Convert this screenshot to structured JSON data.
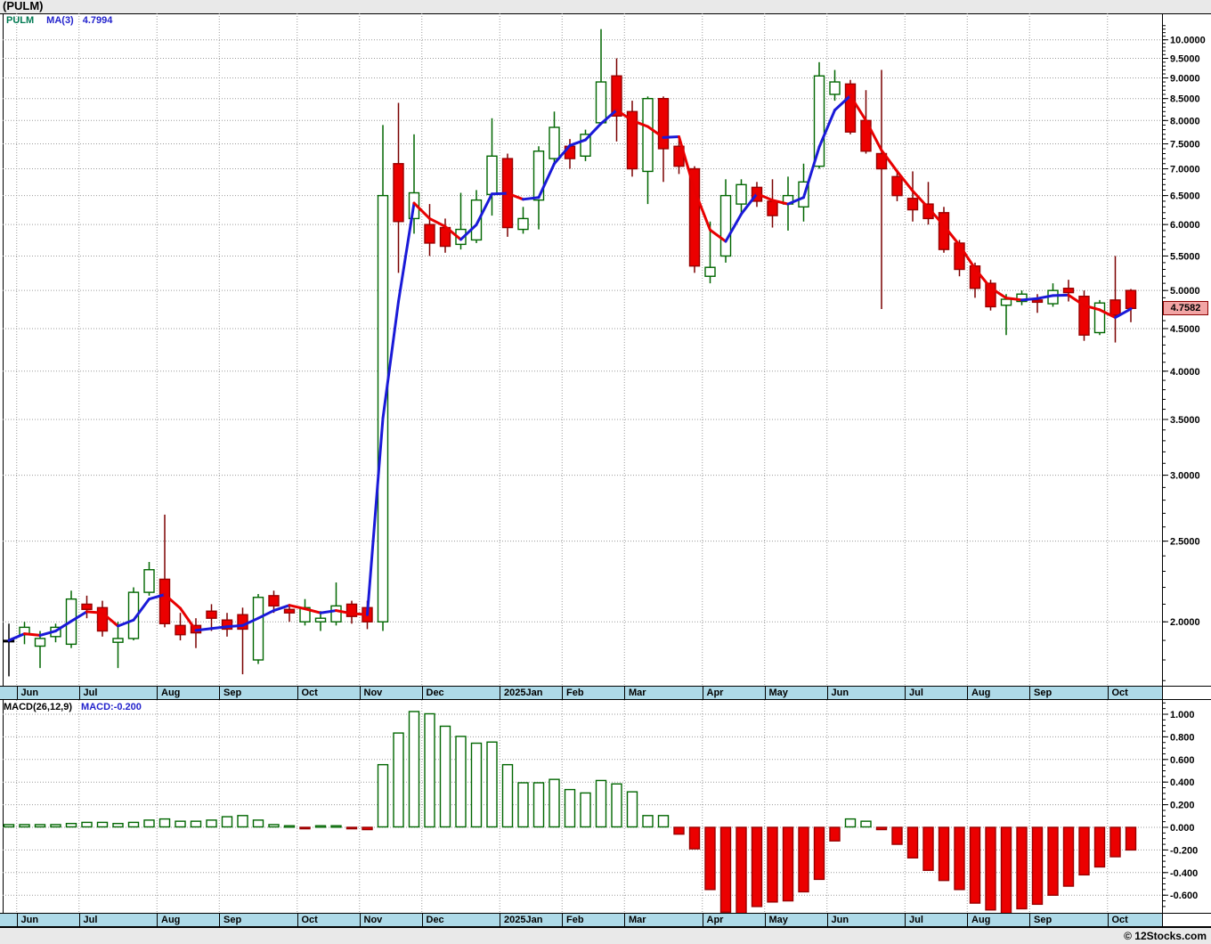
{
  "title": "(PULM)",
  "footer": "© 12Stocks.com",
  "price_chart": {
    "legend": {
      "symbol": "PULM",
      "ma_label": "MA(3)",
      "ma_value": "4.7994"
    },
    "last_price_badge": "4.7582",
    "axis_labels": [
      "10.0000",
      "9.5000",
      "9.0000",
      "8.5000",
      "8.0000",
      "7.5000",
      "7.0000",
      "6.5000",
      "6.0000",
      "5.5000",
      "5.0000",
      "4.5000",
      "4.0000",
      "3.5000",
      "3.0000",
      "2.5000",
      "2.0000"
    ]
  },
  "macd_panel": {
    "legend_label": "MACD(26,12,9)",
    "legend_value": "MACD:-0.200",
    "axis_labels": [
      "1.000",
      "0.800",
      "0.600",
      "0.400",
      "0.200",
      "0.000",
      "-0.200",
      "-0.400",
      "-0.600"
    ]
  },
  "month_axis": {
    "labels": [
      "Jun",
      "Jul",
      "Aug",
      "Sep",
      "Oct",
      "Nov",
      "Dec",
      "2025Jan",
      "Feb",
      "Mar",
      "Apr",
      "May",
      "Jun",
      "Jul",
      "Aug",
      "Sep",
      "Oct"
    ],
    "start_indices": [
      1,
      5,
      10,
      14,
      19,
      23,
      27,
      32,
      36,
      40,
      45,
      49,
      53,
      58,
      62,
      66,
      71
    ]
  },
  "colors": {
    "up": "#006600",
    "up_fill": "#FFFFFF",
    "down": "#EB0000",
    "down_border": "#990000",
    "down_wick": "#7A0000",
    "neutral": "#000000",
    "ma_up": "#1A1AD8",
    "ma_down": "#E80000",
    "grid": "#9A9A9A",
    "axis": "#000000",
    "strip": "#AEDAE8",
    "badge_bg": "#F2A5A5",
    "page_bg": "#E9E9E9",
    "plot_bg": "#FFFFFF"
  },
  "chart_data": [
    {
      "type": "candlestick",
      "title": "PULM weekly candles with MA(3)",
      "symbol": "PULM",
      "interval": "weekly",
      "y_scale": "log",
      "ylim": [
        1.68,
        10.76
      ],
      "ytick_step": 0.5,
      "x_months": [
        "Jun",
        "Jul",
        "Aug",
        "Sep",
        "Oct",
        "Nov",
        "Dec",
        "2025Jan",
        "Feb",
        "Mar",
        "Apr",
        "May",
        "Jun",
        "Jul",
        "Aug",
        "Sep",
        "Oct"
      ],
      "ma_period": 3,
      "ma_last": 4.7994,
      "last_close": 4.7582,
      "ohlc": [
        [
          1.9,
          1.99,
          1.72,
          1.9,
          "k"
        ],
        [
          1.93,
          2.0,
          1.88,
          1.97
        ],
        [
          1.87,
          1.95,
          1.76,
          1.91
        ],
        [
          1.92,
          1.99,
          1.89,
          1.97
        ],
        [
          1.88,
          2.18,
          1.86,
          2.13
        ],
        [
          2.1,
          2.15,
          2.02,
          2.07
        ],
        [
          2.08,
          2.12,
          1.92,
          1.95
        ],
        [
          1.89,
          2.0,
          1.76,
          1.91
        ],
        [
          1.91,
          2.2,
          1.9,
          2.17
        ],
        [
          2.17,
          2.36,
          2.15,
          2.31
        ],
        [
          2.25,
          2.69,
          1.97,
          1.99
        ],
        [
          1.98,
          2.05,
          1.9,
          1.93
        ],
        [
          1.98,
          2.02,
          1.86,
          1.94
        ],
        [
          2.06,
          2.1,
          1.95,
          2.02
        ],
        [
          2.01,
          2.05,
          1.92,
          1.96
        ],
        [
          2.04,
          2.08,
          1.73,
          1.96
        ],
        [
          1.8,
          2.16,
          1.78,
          2.14
        ],
        [
          2.15,
          2.18,
          2.05,
          2.09
        ],
        [
          2.07,
          2.1,
          2.0,
          2.05
        ],
        [
          2.0,
          2.13,
          1.98,
          2.08
        ],
        [
          2.0,
          2.06,
          1.95,
          2.02
        ],
        [
          2.0,
          2.23,
          1.98,
          2.09
        ],
        [
          2.1,
          2.12,
          1.99,
          2.03
        ],
        [
          2.08,
          2.12,
          1.96,
          2.0
        ],
        [
          2.0,
          7.9,
          1.95,
          6.5
        ],
        [
          7.1,
          8.4,
          5.25,
          6.05
        ],
        [
          6.1,
          7.7,
          5.85,
          6.55
        ],
        [
          6.0,
          6.35,
          5.5,
          5.7
        ],
        [
          5.95,
          6.1,
          5.55,
          5.65
        ],
        [
          5.68,
          6.55,
          5.6,
          5.92
        ],
        [
          5.75,
          6.6,
          5.7,
          6.42
        ],
        [
          6.52,
          8.05,
          6.15,
          7.25
        ],
        [
          7.2,
          7.3,
          5.8,
          5.95
        ],
        [
          5.92,
          6.3,
          5.85,
          6.1
        ],
        [
          6.42,
          7.45,
          5.92,
          7.35
        ],
        [
          7.2,
          8.2,
          7.1,
          7.85
        ],
        [
          7.45,
          7.6,
          7.0,
          7.2
        ],
        [
          7.25,
          7.8,
          7.15,
          7.7
        ],
        [
          7.95,
          10.3,
          7.9,
          8.9
        ],
        [
          9.05,
          9.5,
          7.55,
          8.1
        ],
        [
          8.2,
          8.45,
          6.85,
          7.0
        ],
        [
          6.95,
          8.55,
          6.35,
          8.5
        ],
        [
          8.5,
          8.55,
          6.75,
          7.4
        ],
        [
          7.45,
          7.6,
          6.9,
          7.05
        ],
        [
          7.0,
          7.05,
          5.25,
          5.35
        ],
        [
          5.2,
          6.05,
          5.1,
          5.33
        ],
        [
          5.5,
          6.8,
          5.4,
          6.5
        ],
        [
          6.35,
          6.8,
          6.15,
          6.7
        ],
        [
          6.65,
          6.75,
          6.3,
          6.4
        ],
        [
          6.4,
          6.8,
          5.95,
          6.15
        ],
        [
          6.35,
          6.85,
          5.9,
          6.5
        ],
        [
          6.3,
          7.1,
          6.05,
          6.75
        ],
        [
          7.05,
          9.4,
          7.0,
          9.05
        ],
        [
          8.6,
          9.2,
          8.45,
          8.9
        ],
        [
          8.85,
          8.95,
          7.7,
          7.75
        ],
        [
          8.0,
          8.7,
          7.3,
          7.35
        ],
        [
          7.3,
          9.2,
          4.75,
          7.0
        ],
        [
          6.85,
          6.95,
          6.4,
          6.5
        ],
        [
          6.45,
          6.95,
          6.05,
          6.25
        ],
        [
          6.35,
          6.75,
          6.0,
          6.1
        ],
        [
          6.2,
          6.3,
          5.55,
          5.6
        ],
        [
          5.7,
          5.75,
          5.2,
          5.3
        ],
        [
          5.35,
          5.4,
          4.9,
          5.03
        ],
        [
          5.1,
          5.15,
          4.73,
          4.78
        ],
        [
          4.8,
          4.95,
          4.42,
          4.88
        ],
        [
          4.85,
          5.0,
          4.8,
          4.95
        ],
        [
          4.87,
          4.95,
          4.7,
          4.84
        ],
        [
          4.82,
          5.1,
          4.78,
          5.0
        ],
        [
          5.03,
          5.15,
          4.85,
          4.97
        ],
        [
          4.92,
          5.0,
          4.35,
          4.42
        ],
        [
          4.45,
          4.87,
          4.42,
          4.83
        ],
        [
          4.87,
          5.5,
          4.33,
          4.67
        ],
        [
          5.0,
          5.02,
          4.58,
          4.7582
        ]
      ]
    },
    {
      "type": "bar",
      "title": "MACD(26,12,9) histogram",
      "ylim": [
        -0.756,
        1.126
      ],
      "ytick_step": 0.2,
      "last_value": -0.2,
      "values": [
        0.02,
        0.02,
        0.02,
        0.02,
        0.03,
        0.04,
        0.04,
        0.03,
        0.04,
        0.06,
        0.07,
        0.05,
        0.05,
        0.06,
        0.09,
        0.1,
        0.06,
        0.02,
        0.01,
        -0.01,
        0.01,
        0.01,
        -0.01,
        -0.02,
        0.55,
        0.83,
        1.02,
        1.0,
        0.89,
        0.8,
        0.74,
        0.75,
        0.55,
        0.39,
        0.39,
        0.42,
        0.33,
        0.3,
        0.41,
        0.38,
        0.31,
        0.1,
        0.1,
        -0.06,
        -0.19,
        -0.55,
        -0.75,
        -0.77,
        -0.7,
        -0.66,
        -0.65,
        -0.57,
        -0.46,
        -0.12,
        0.07,
        0.05,
        -0.02,
        -0.15,
        -0.27,
        -0.38,
        -0.47,
        -0.55,
        -0.67,
        -0.73,
        -0.77,
        -0.72,
        -0.68,
        -0.6,
        -0.52,
        -0.42,
        -0.35,
        -0.26,
        -0.2
      ]
    }
  ]
}
